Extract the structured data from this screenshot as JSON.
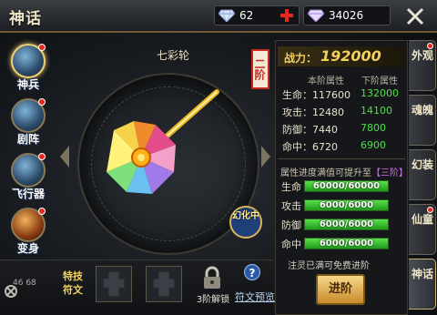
{
  "header": {
    "title": "神话",
    "diamonds": "62",
    "gems": "34026"
  },
  "left_nav": [
    {
      "label": "神兵",
      "active": true,
      "badge": true
    },
    {
      "label": "剧阵",
      "active": false,
      "badge": true
    },
    {
      "label": "飞行器",
      "active": false,
      "badge": true
    },
    {
      "label": "变身",
      "active": false,
      "badge": true
    }
  ],
  "stage": {
    "weapon_name": "七彩轮",
    "tier_seal": "二阶",
    "transform_label": "幻化中"
  },
  "bottom": {
    "skill_label": "特技符文",
    "lock_label": "3阶解锁",
    "help": "?",
    "preview_link": "符文预览",
    "corner_numbers": "46 68"
  },
  "info": {
    "power_label": "战力：",
    "power_value": "192000",
    "col_current": "本阶属性",
    "col_next": "下阶属性",
    "stats": [
      {
        "current": "生命：117600",
        "next": "132000"
      },
      {
        "current": "攻击：12480",
        "next": "14100"
      },
      {
        "current": "防御：7440",
        "next": "7800"
      },
      {
        "current": "命中：6720",
        "next": "6900"
      }
    ],
    "progress_title_prefix": "属性进度满值可提升至",
    "progress_title_tier": "【三阶】",
    "progress": [
      {
        "label": "生命",
        "text": "60000/60000",
        "fraction": 1.0
      },
      {
        "label": "攻击",
        "text": "6000/6000",
        "fraction": 1.0
      },
      {
        "label": "防御",
        "text": "6000/6000",
        "fraction": 1.0
      },
      {
        "label": "命中",
        "text": "6000/6000",
        "fraction": 1.0
      }
    ],
    "free_note": "注灵已满可免费进阶",
    "advance_button": "进阶"
  },
  "right_tabs": [
    {
      "label": "外观",
      "active": false,
      "badge": true
    },
    {
      "label": "魂魄",
      "active": false,
      "badge": false
    },
    {
      "label": "幻装",
      "active": false,
      "badge": false
    },
    {
      "label": "仙童",
      "active": false,
      "badge": true
    },
    {
      "label": "神话",
      "active": true,
      "badge": false
    }
  ],
  "colors": {
    "gold": "#f1cf60",
    "green_stat": "#4fe04a",
    "seal_red": "#c8291f"
  }
}
